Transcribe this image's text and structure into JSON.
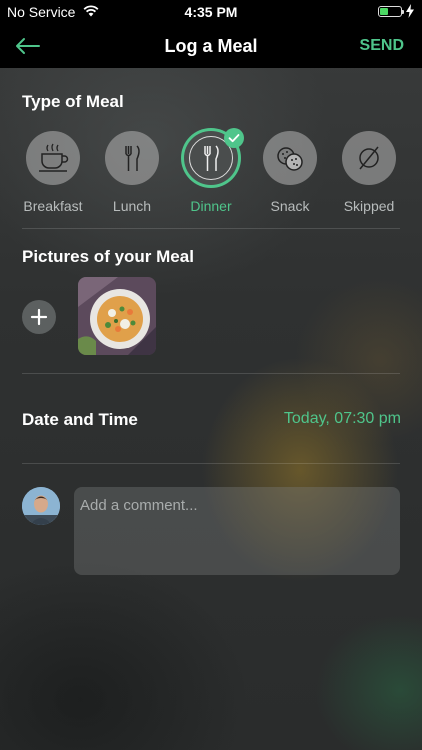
{
  "status_bar": {
    "carrier": "No Service",
    "time": "4:35 PM",
    "battery_level": 0.45
  },
  "nav": {
    "title": "Log a Meal",
    "send_label": "SEND"
  },
  "meal_type": {
    "title": "Type of Meal",
    "selected": "Dinner",
    "options": [
      {
        "label": "Breakfast",
        "icon": "coffee-cup-icon"
      },
      {
        "label": "Lunch",
        "icon": "fork-knife-icon"
      },
      {
        "label": "Dinner",
        "icon": "fork-knife-icon"
      },
      {
        "label": "Snack",
        "icon": "cookies-icon"
      },
      {
        "label": "Skipped",
        "icon": "empty-set-icon"
      }
    ]
  },
  "pictures": {
    "title": "Pictures of your Meal"
  },
  "date_time": {
    "title": "Date and Time",
    "value": "Today, 07:30 pm"
  },
  "comment": {
    "placeholder": "Add a comment..."
  },
  "colors": {
    "accent": "#4fc58b",
    "bar_background": "#000000"
  }
}
